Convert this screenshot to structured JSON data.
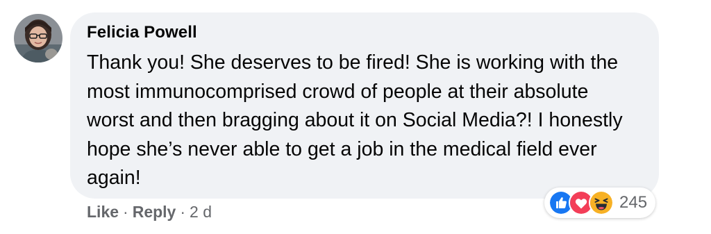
{
  "comment": {
    "author": "Felicia Powell",
    "text": "Thank you! She deserves to be fired! She is working with the most immunocomprised crowd of people at their absolute worst and then bragging about it on Social Media?! I honestly hope she’s never able to get a job in the medical field ever again!",
    "actions": {
      "like_label": "Like",
      "separator": "·",
      "reply_label": "Reply",
      "timestamp": "2 d"
    },
    "reactions": {
      "icons": [
        "like-icon",
        "love-icon",
        "haha-icon"
      ],
      "count": "245"
    }
  },
  "colors": {
    "bubble": "#f0f2f5",
    "secondary_text": "#65676b",
    "like_blue": "#1877f2",
    "love_red": "#f33e58",
    "haha_yellow": "#f7b125"
  }
}
